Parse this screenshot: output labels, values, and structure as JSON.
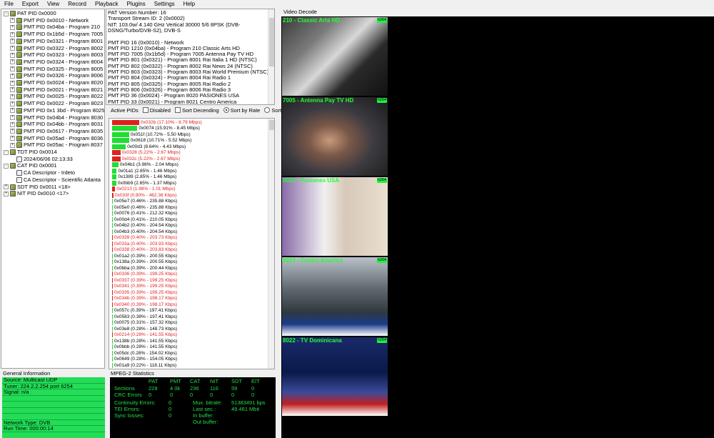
{
  "menu": [
    "File",
    "Export",
    "View",
    "Record",
    "Playback",
    "Plugins",
    "Settings",
    "Help"
  ],
  "tree": [
    {
      "level": 0,
      "text": "PAT PID 0x0000",
      "icon": "pmt-icon",
      "exp": "-"
    },
    {
      "level": 1,
      "text": "PMT PID 0x0010 - Network",
      "icon": "pmt-icon",
      "exp": "+"
    },
    {
      "level": 1,
      "text": "PMT PID 0x04ba - Program 210",
      "icon": "pmt-icon",
      "exp": "+"
    },
    {
      "level": 1,
      "text": "PMT PID 0x1b5d - Program 7005",
      "icon": "pmt-icon",
      "exp": "+"
    },
    {
      "level": 1,
      "text": "PMT PID 0x0321 - Program 8001",
      "icon": "pmt-icon",
      "exp": "+"
    },
    {
      "level": 1,
      "text": "PMT PID 0x0322 - Program 8002",
      "icon": "pmt-icon",
      "exp": "+"
    },
    {
      "level": 1,
      "text": "PMT PID 0x0323 - Program 8003",
      "icon": "pmt-icon",
      "exp": "+"
    },
    {
      "level": 1,
      "text": "PMT PID 0x0324 - Program 8004",
      "icon": "pmt-icon",
      "exp": "+"
    },
    {
      "level": 1,
      "text": "PMT PID 0x0325 - Program 8005",
      "icon": "pmt-icon",
      "exp": "+"
    },
    {
      "level": 1,
      "text": "PMT PID 0x0326 - Program 8006",
      "icon": "pmt-icon",
      "exp": "+"
    },
    {
      "level": 1,
      "text": "PMT PID 0x0024 - Program 8020",
      "icon": "pmt-icon",
      "exp": "+"
    },
    {
      "level": 1,
      "text": "PMT PID 0x0021 - Program 8021",
      "icon": "pmt-icon",
      "exp": "+"
    },
    {
      "level": 1,
      "text": "PMT PID 0x0025 - Program 8022",
      "icon": "pmt-icon",
      "exp": "+"
    },
    {
      "level": 1,
      "text": "PMT PID 0x0022 - Program 8023",
      "icon": "pmt-icon",
      "exp": "+"
    },
    {
      "level": 1,
      "text": "PMT PID 0x1 3bd - Program 8025",
      "icon": "pmt-icon",
      "exp": "+"
    },
    {
      "level": 1,
      "text": "PMT PID 0x04b4 - Program 8030",
      "icon": "pmt-icon",
      "exp": "+"
    },
    {
      "level": 1,
      "text": "PMT PID 0x04bb - Program 8031",
      "icon": "pmt-icon",
      "exp": "+"
    },
    {
      "level": 1,
      "text": "PMT PID 0x0617 - Program 8035",
      "icon": "pmt-icon",
      "exp": "+"
    },
    {
      "level": 1,
      "text": "PMT PID 0x05ad - Program 8036",
      "icon": "pmt-icon",
      "exp": "+"
    },
    {
      "level": 1,
      "text": "PMT PID 0x05ac - Program 8037",
      "icon": "pmt-icon",
      "exp": "+"
    },
    {
      "level": 0,
      "text": "TDT PID 0x0014",
      "icon": "pmt-icon",
      "exp": "-"
    },
    {
      "level": 1,
      "text": "2024/06/06 02:13:33",
      "icon": "doc-icon",
      "exp": ""
    },
    {
      "level": 0,
      "text": "CAT PID 0x0001",
      "icon": "pmt-icon",
      "exp": "-"
    },
    {
      "level": 1,
      "text": "CA Descriptor - Irdeto",
      "icon": "doc-icon",
      "exp": ""
    },
    {
      "level": 1,
      "text": "CA Descriptor - Scientific Atlanta",
      "icon": "doc-icon",
      "exp": ""
    },
    {
      "level": 0,
      "text": "SDT PID 0x0011 <18>",
      "icon": "pmt-icon",
      "exp": "+"
    },
    {
      "level": 0,
      "text": "NIT PID 0x0010 <17>",
      "icon": "pmt-icon",
      "exp": "+"
    }
  ],
  "info_lines": [
    "PAT Version Number: 16",
    "Transport Stream ID: 2 (0x0002)",
    "NIT: 103.0w/ 4.140 GHz Vertical 30000 5/6 8PSK (DVB-",
    "DSNG/Turbo/DVB-S2), DVB-S",
    "",
    "PMT PID 16 (0x0010) - Network",
    "PMT PID 1210 (0x04ba) - Program 210 Classic Arts HD",
    "PMT PID 7005 (0x1b5d) - Program 7005 Antenna Pay TV HD",
    "PMT PID 801 (0x0321) - Program 8001 Rai Italia 1 HD (NTSC)",
    "PMT PID 802 (0x0322) - Program 8002 Rai News 24 (NTSC)",
    "PMT PID 803 (0x0323) - Program 8003 Rai World Premium (NTSC)",
    "PMT PID 804 (0x0324) - Program 8004 Rai Radio 1",
    "PMT PID 805 (0x0325) - Program 8005 Rai Radio 2",
    "PMT PID 806 (0x0326) - Program 8006 Rai Radio 3",
    "PMT PID 36 (0x0024) - Program 8020 PASIONES USA",
    "PMT PID 33 (0x0021) - Program 8021 Centro America"
  ],
  "active_pids": {
    "label": "Active PIDs",
    "options": [
      {
        "label": "Disabled",
        "type": "checkbox",
        "checked": false
      },
      {
        "label": "Sort Decending",
        "type": "checkbox",
        "checked": false
      },
      {
        "label": "Sort by Rate",
        "type": "radio",
        "checked": true
      },
      {
        "label": "Sort by PID",
        "type": "radio",
        "checked": false
      }
    ],
    "rows": [
      {
        "text": "0x032b (17.10% - 8.79 Mbps)",
        "pct": 17.1,
        "color": "#e02020"
      },
      {
        "text": "0x0074 (15.91% - 8.45 Mbps)",
        "pct": 15.91,
        "color": "#22dd33"
      },
      {
        "text": "0x051f (10.72% - 5.50 Mbps)",
        "pct": 10.72,
        "color": "#22dd33"
      },
      {
        "text": "0x0618 (10.71% - 5.52 Mbps)",
        "pct": 10.71,
        "color": "#22dd33"
      },
      {
        "text": "0x00d3 (8.64% - 4.43 Mbps)",
        "pct": 8.64,
        "color": "#22dd33"
      },
      {
        "text": "0x0328 (5.22% - 2.67 Mbps)",
        "pct": 5.22,
        "color": "#e02020"
      },
      {
        "text": "0x032c (5.22% - 2.67 Mbps)",
        "pct": 5.22,
        "color": "#e02020"
      },
      {
        "text": "0x04b1 (3.98% - 2.04 Mbps)",
        "pct": 3.98,
        "color": "#22dd33"
      },
      {
        "text": "0x01a1 (2.85% - 1.46 Mbps)",
        "pct": 2.85,
        "color": "#22dd33"
      },
      {
        "text": "0x1389 (2.85% - 1.46 Mbps)",
        "pct": 2.85,
        "color": "#22dd33"
      },
      {
        "text": "0x0bb9 (2.65% - 1.37 Mbps)",
        "pct": 2.65,
        "color": "#22dd33"
      },
      {
        "text": "0x0213 (1.98% - 1.01 Mbps)",
        "pct": 1.98,
        "color": "#e02020"
      },
      {
        "text": "0x033f (0.90% - 462.36 Kbps)",
        "pct": 0.9,
        "color": "#e02020"
      },
      {
        "text": "0x05e7 (0.46% - 235.88 Kbps)",
        "pct": 0.46,
        "color": "#22dd33"
      },
      {
        "text": "0x05e0 (0.46% - 235.88 Kbps)",
        "pct": 0.46,
        "color": "#22dd33"
      },
      {
        "text": "0x0076 (0.41% - 212.32 Kbps)",
        "pct": 0.41,
        "color": "#22dd33"
      },
      {
        "text": "0x00d4 (0.41% - 210.05 Kbps)",
        "pct": 0.41,
        "color": "#22dd33"
      },
      {
        "text": "0x04b2 (0.40% - 204.54 Kbps)",
        "pct": 0.4,
        "color": "#22dd33"
      },
      {
        "text": "0x04b3 (0.40% - 204.54 Kbps)",
        "pct": 0.4,
        "color": "#22dd33"
      },
      {
        "text": "0x0339 (0.40% - 203.73 Kbps)",
        "pct": 0.4,
        "color": "#e02020"
      },
      {
        "text": "0x033a (0.40% - 203.93 Kbps)",
        "pct": 0.4,
        "color": "#e02020"
      },
      {
        "text": "0x0338 (0.40% - 203.83 Kbps)",
        "pct": 0.4,
        "color": "#e02020"
      },
      {
        "text": "0x01a2 (0.39% - 200.55 Kbps)",
        "pct": 0.39,
        "color": "#22dd33"
      },
      {
        "text": "0x138a (0.39% - 200.55 Kbps)",
        "pct": 0.39,
        "color": "#22dd33"
      },
      {
        "text": "0x0bba (0.39% - 200.44 Kbps)",
        "pct": 0.39,
        "color": "#22dd33"
      },
      {
        "text": "0x0336 (0.39% - 199.25 Kbps)",
        "pct": 0.39,
        "color": "#e02020"
      },
      {
        "text": "0x0337 (0.39% - 199.25 Kbps)",
        "pct": 0.39,
        "color": "#e02020"
      },
      {
        "text": "0x0341 (0.39% - 199.25 Kbps)",
        "pct": 0.39,
        "color": "#e02020"
      },
      {
        "text": "0x0335 (0.39% - 199.25 Kbps)",
        "pct": 0.39,
        "color": "#e02020"
      },
      {
        "text": "0x034b (0.39% - 198.17 Kbps)",
        "pct": 0.39,
        "color": "#e02020"
      },
      {
        "text": "0x0340 (0.39% - 198.17 Kbps)",
        "pct": 0.39,
        "color": "#e02020"
      },
      {
        "text": "0x057c (0.39% - 197.41 Kbps)",
        "pct": 0.39,
        "color": "#22dd33"
      },
      {
        "text": "0x0583 (0.38% - 197.41 Kbps)",
        "pct": 0.38,
        "color": "#22dd33"
      },
      {
        "text": "0x0075 (0.31% - 157.32 Kbps)",
        "pct": 0.31,
        "color": "#22dd33"
      },
      {
        "text": "0x03e8 (0.28% - 148.73 Kbps)",
        "pct": 0.28,
        "color": "#22dd33"
      },
      {
        "text": "0x0214 (0.28% - 141.55 Kbps)",
        "pct": 0.28,
        "color": "#e02020"
      },
      {
        "text": "0x138b (0.28% - 141.55 Kbps)",
        "pct": 0.28,
        "color": "#22dd33"
      },
      {
        "text": "0x0bbb (0.28% - 141.55 Kbps)",
        "pct": 0.28,
        "color": "#22dd33"
      },
      {
        "text": "0x05dc (0.28% - 154.02 Kbps)",
        "pct": 0.28,
        "color": "#22dd33"
      },
      {
        "text": "0x0649 (0.28% - 154.05 Kbps)",
        "pct": 0.28,
        "color": "#22dd33"
      },
      {
        "text": "0x01a9 (0.22% - 118.11 Kbps)",
        "pct": 0.22,
        "color": "#22dd33"
      }
    ]
  },
  "general_info": {
    "title": "General Information",
    "rows": [
      "Source: Multicast UDP",
      "Tuner: 224.2.2.254 port 6254",
      "Signal: n/a",
      "",
      "",
      "",
      "",
      "Network Type: DVB",
      "Run Time: 000:00:14"
    ]
  },
  "stats": {
    "title": "MPEG-2 Statistics",
    "headers": [
      "PAT",
      "PMT",
      "CAT",
      "NIT",
      "SDT",
      "EIT"
    ],
    "sections_label": "Sections",
    "sections": [
      "228",
      "4.0k",
      "236",
      "116",
      "59",
      "0"
    ],
    "crc_label": "CRC Errors",
    "crc": [
      "0",
      "0",
      "0",
      "0",
      "0",
      "0"
    ],
    "left_labels": [
      "Continuity Errors:",
      "TEI Errors:",
      "Sync losses:"
    ],
    "left_values": [
      "0",
      "0",
      "0"
    ],
    "right_labels": [
      "Mux. bitrate:",
      "Last sec.:",
      "In buffer:",
      "Out buffer:"
    ],
    "right_values": [
      "51383491 bps",
      "49.461 Mbit",
      "",
      ""
    ]
  },
  "video": {
    "title": "Video Decode",
    "badge": "h264",
    "tiles": [
      {
        "title": "210 - Classic Arts HD",
        "bg": "linear-gradient(135deg,#3a3a3a 0%,#7a7a7a 30%,#d8d8d8 50%,#2a2a2a 70%,#111 100%)"
      },
      {
        "title": "7005 - Antenna Pay TV HD",
        "bg": "radial-gradient(ellipse at 45% 55%,#c89a7a 0%,#7a5848 25%,#3a3a40 55%,#1a1a1a 100%)"
      },
      {
        "title": "8022 - Pasiones USA",
        "bg": "linear-gradient(90deg,#8a6aa8 0%,#f0f0f0 40%,#d8c8b8 60%,#e8e0d0 100%)"
      },
      {
        "title": "8023 - Centro America",
        "bg": "linear-gradient(180deg,#b8c0c8 0%,#606870 40%,#303840 70%,#1a3a8a 85%,#ffffff 100%)"
      },
      {
        "title": "8022 - TV Dominicana",
        "bg": "linear-gradient(180deg,#1a2a6a 0%,#0a1a4a 45%,#3a4a9a 70%,#c02020 85%,#ffffff 100%)"
      }
    ]
  }
}
